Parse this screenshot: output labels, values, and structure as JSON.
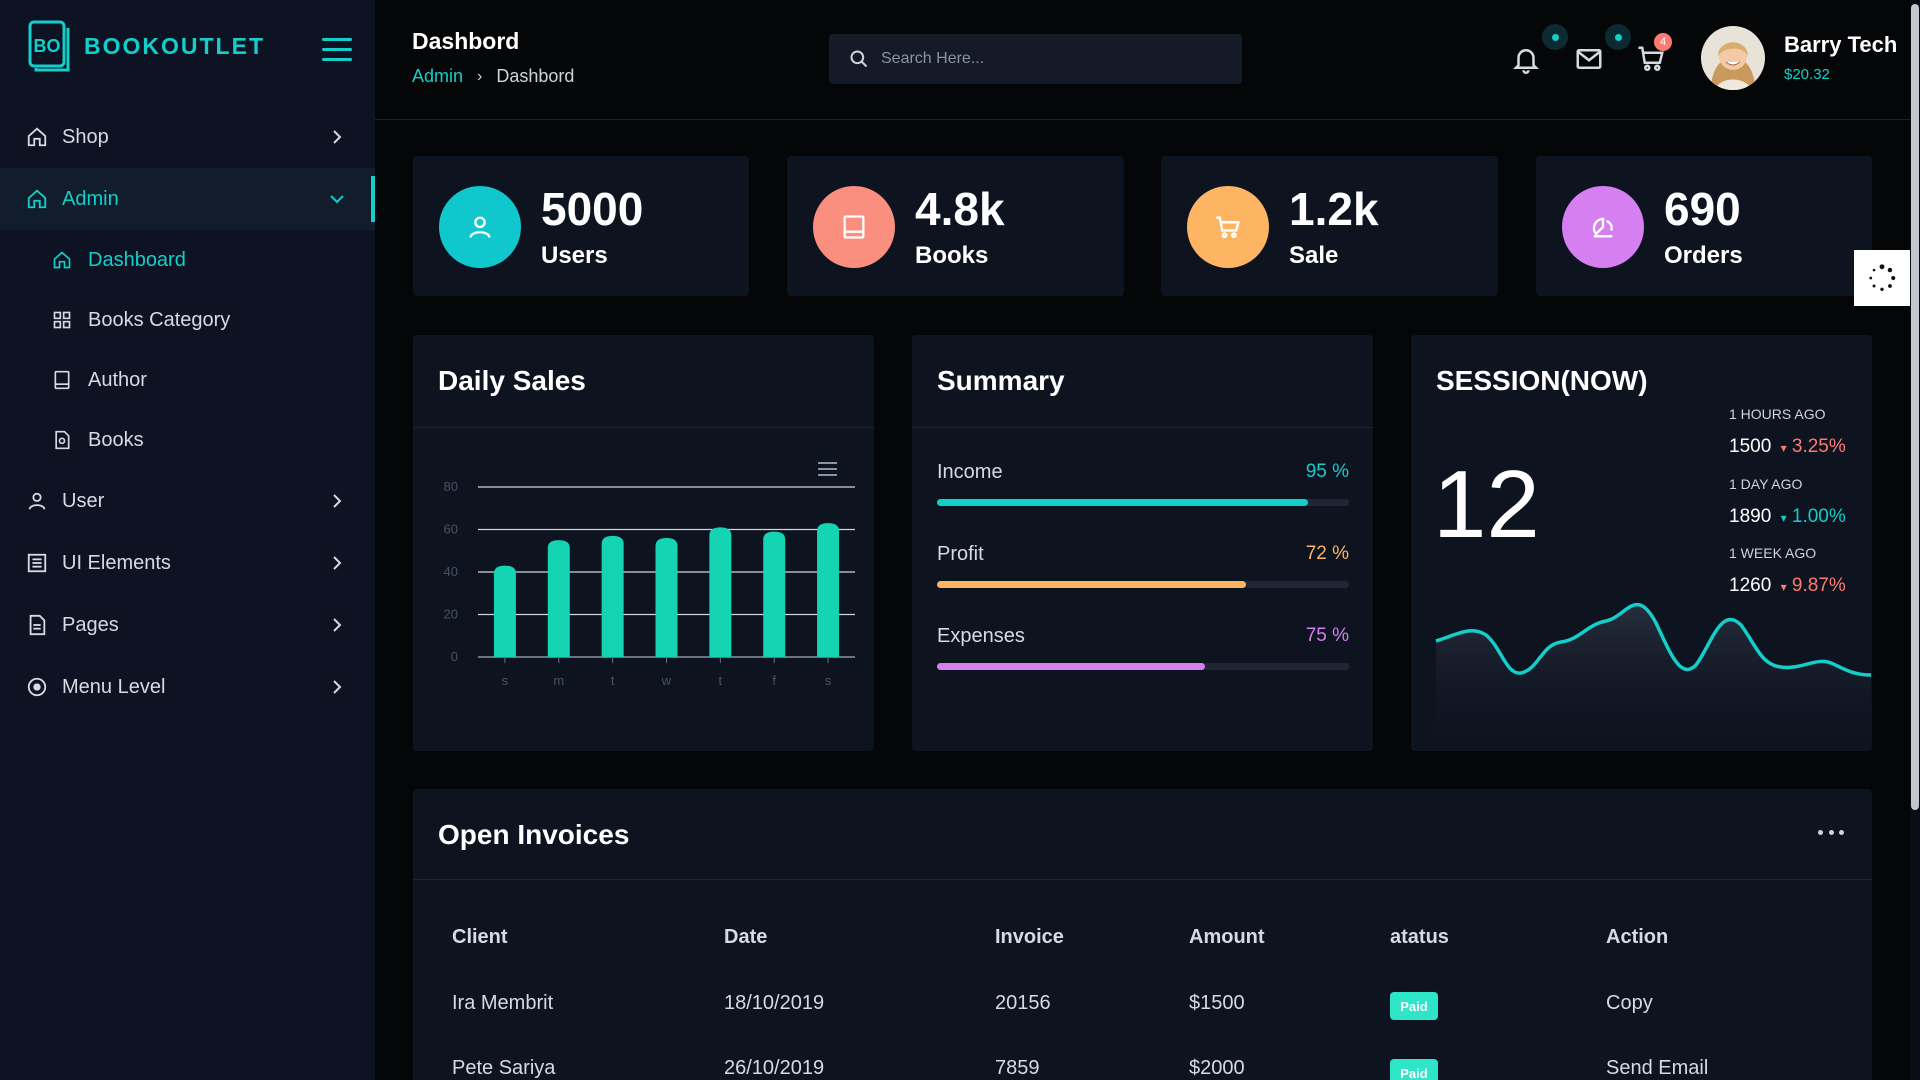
{
  "brand": {
    "name": "BOOKOUTLET",
    "logo_letters": "BO"
  },
  "sidebar": {
    "items": [
      {
        "label": "Shop",
        "icon": "home-icon"
      },
      {
        "label": "Admin",
        "icon": "home-icon",
        "active": true
      },
      {
        "label": "User",
        "icon": "user-icon"
      },
      {
        "label": "UI Elements",
        "icon": "list-icon"
      },
      {
        "label": "Pages",
        "icon": "page-icon"
      },
      {
        "label": "Menu Level",
        "icon": "circle-dot-icon"
      }
    ],
    "admin_sub": [
      {
        "label": "Dashboard",
        "icon": "home-icon",
        "current": true
      },
      {
        "label": "Books Category",
        "icon": "grid-icon"
      },
      {
        "label": "Author",
        "icon": "book-icon"
      },
      {
        "label": "Books",
        "icon": "file-icon"
      }
    ]
  },
  "header": {
    "title": "Dashbord",
    "breadcrumb": {
      "parent": "Admin",
      "separator": "›",
      "current": "Dashbord"
    },
    "search_placeholder": "Search Here...",
    "cart_count": "4",
    "user": {
      "name": "Barry Tech",
      "balance": "$20.32"
    }
  },
  "stats": [
    {
      "value": "5000",
      "label": "Users",
      "color": "#0fc7cc",
      "icon": "user-icon"
    },
    {
      "value": "4.8k",
      "label": "Books",
      "color": "#fb8f7f",
      "icon": "book-icon"
    },
    {
      "value": "1.2k",
      "label": "Sale",
      "color": "#fdb563",
      "icon": "cart-icon"
    },
    {
      "value": "690",
      "label": "Orders",
      "color": "#d67ff0",
      "icon": "orders-icon"
    }
  ],
  "daily_sales": {
    "title": "Daily Sales"
  },
  "chart_data": {
    "type": "bar",
    "categories": [
      "s",
      "m",
      "t",
      "w",
      "t",
      "f",
      "s"
    ],
    "values": [
      43,
      55,
      57,
      56,
      61,
      59,
      63
    ],
    "yticks": [
      "0",
      "20",
      "40",
      "60",
      "80"
    ],
    "ylim": [
      0,
      80
    ],
    "grid": true,
    "color": "#14d4b4"
  },
  "summary": {
    "title": "Summary",
    "rows": [
      {
        "label": "Income",
        "pct_text": "95 %",
        "fill": 0.9,
        "color": "#14cec9"
      },
      {
        "label": "Profit",
        "pct_text": "72 %",
        "fill": 0.75,
        "color": "#fdb563"
      },
      {
        "label": "Expenses",
        "pct_text": "75 %",
        "fill": 0.65,
        "color": "#d67ff0"
      }
    ]
  },
  "session": {
    "title": "SESSION(NOW)",
    "count": "12",
    "history": [
      {
        "time": "1 HOURS AGO",
        "value": "1500",
        "change": "3.25%",
        "dir": "down",
        "color": "#ff7b72"
      },
      {
        "time": "1 DAY AGO",
        "value": "1890",
        "change": "1.00%",
        "dir": "down",
        "color": "#14cec9"
      },
      {
        "time": "1 WEEK AGO",
        "value": "1260",
        "change": "9.87%",
        "dir": "down",
        "color": "#ff7b72"
      }
    ],
    "line_color": "#14cec9"
  },
  "invoices": {
    "title": "Open Invoices",
    "columns": [
      "Client",
      "Date",
      "Invoice",
      "Amount",
      "atatus",
      "Action"
    ],
    "rows": [
      {
        "client": "Ira Membrit",
        "date": "18/10/2019",
        "invoice": "20156",
        "amount": "$1500",
        "status": "Paid",
        "action": "Copy"
      },
      {
        "client": "Pete Sariya",
        "date": "26/10/2019",
        "invoice": "7859",
        "amount": "$2000",
        "status": "Paid",
        "action": "Send Email"
      }
    ]
  }
}
